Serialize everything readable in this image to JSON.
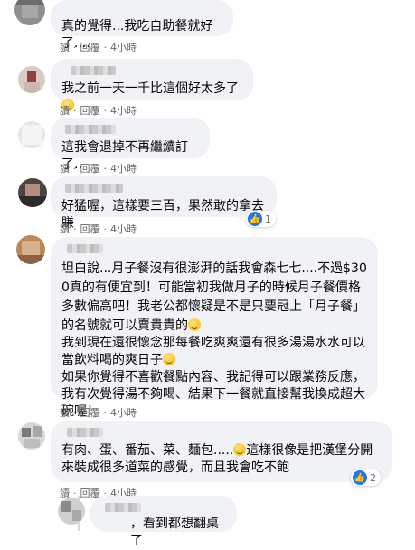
{
  "comments": [
    {
      "text": "真的覺得...我吃自助餐就好了....",
      "read": "讀",
      "reply": "回覆",
      "time": "4小時"
    },
    {
      "text": "我之前一天一千比這個好太多了",
      "read": "讀",
      "reply": "回覆",
      "time": "4小時",
      "emoji": "grinning-emoji"
    },
    {
      "text": "這我會退掉不再繼續訂了..",
      "read": "讀",
      "reply": "回覆",
      "time": "4小時"
    },
    {
      "text": "好猛喔，這樣要三百，果然敢的拿去賺",
      "read": "讀",
      "reply": "回覆",
      "time": "4小時",
      "reaction_count": "1"
    },
    {
      "text": "坦白說...月子餐沒有很澎湃的話我會森七七....不過$300真的有便宜到！可能當初我做月子的時候月子餐價格多數偏高吧！我老公都懷疑是不是只要冠上「月子餐」的名號就可以賣貴貴的",
      "text2": "我到現在還很懷念那每餐吃爽爽還有很多湯湯水水可以當飲料喝的爽日子",
      "text3": "如果你覺得不喜歡餐點內容、我記得可以跟業務反應，我有次覺得湯不夠喝、結果下一餐就直接幫我換成超大碗喔！",
      "read": "讀",
      "reply": "回覆",
      "time": "4小時"
    },
    {
      "text_a": "有肉、蛋、番茄、菜、麵包.....",
      "text_b": "這樣很像是把漢堡分開來裝成很多道菜的感覺，而且我會吃不飽",
      "read": "讀",
      "reply": "回覆",
      "time": "4小時",
      "reaction_count": "2"
    },
    {
      "text": "，看到都想翻桌了"
    }
  ],
  "colors": {
    "bubble": "#f0f2f5",
    "meta": "#65676b",
    "like": "#1877f2"
  }
}
